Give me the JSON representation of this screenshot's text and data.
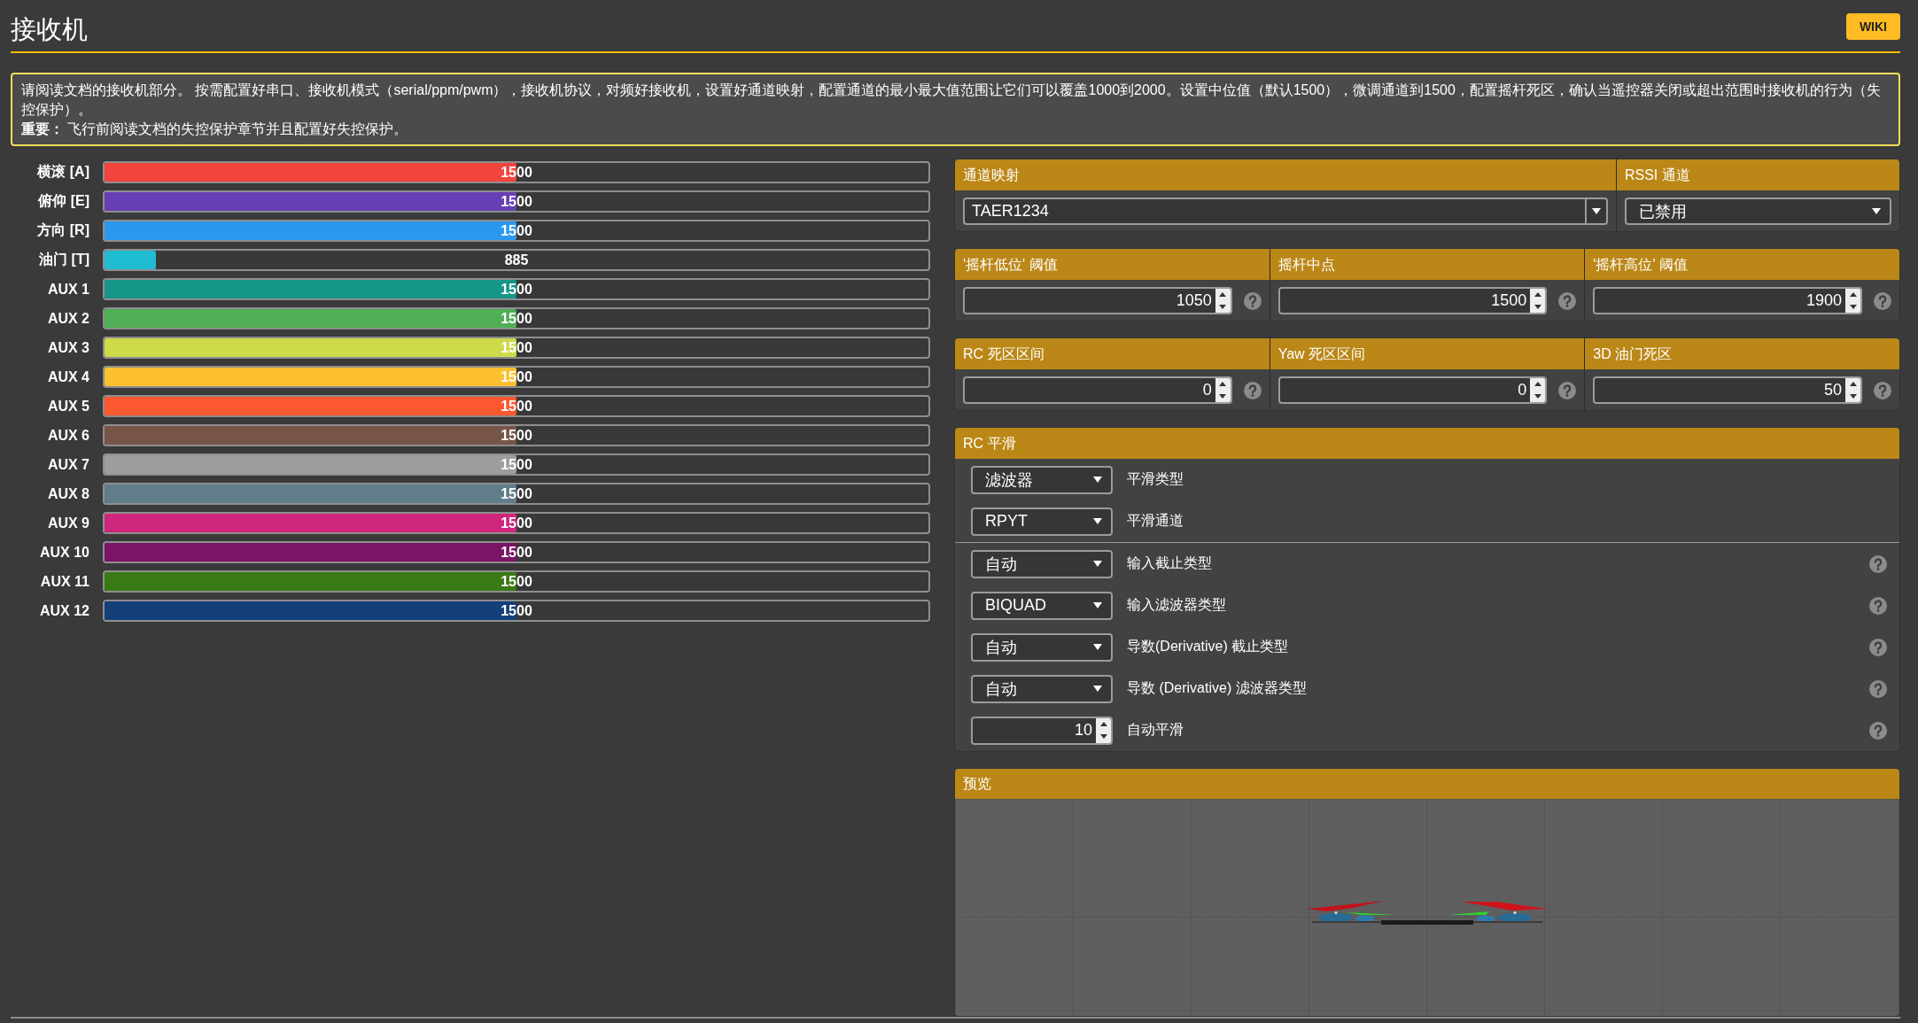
{
  "header": {
    "title": "接收机",
    "wiki": "WIKI"
  },
  "notice": {
    "text": "请阅读文档的接收机部分。 按需配置好串口、接收机模式（serial/ppm/pwm），接收机协议，对频好接收机，设置好通道映射，配置通道的最小最大值范围让它们可以覆盖1000到2000。设置中位值（默认1500），微调通道到1500，配置摇杆死区，确认当遥控器关闭或超出范围时接收机的行为（失控保护）。",
    "important": "**重要：** 飞行前阅读文档的失控保护章节并且配置好失控保护。"
  },
  "channels": [
    {
      "name": "横滚 [A]",
      "value": "1500",
      "level": 0.5,
      "color": "#f1453d"
    },
    {
      "name": "俯仰 [E]",
      "value": "1500",
      "level": 0.5,
      "color": "#673fb4"
    },
    {
      "name": "方向 [R]",
      "value": "1500",
      "level": 0.5,
      "color": "#2b98f0"
    },
    {
      "name": "油门 [T]",
      "value": "885",
      "level": 0.062,
      "color": "#1fbcd2"
    },
    {
      "name": "AUX 1",
      "value": "1500",
      "level": 0.5,
      "color": "#159688"
    },
    {
      "name": "AUX 2",
      "value": "1500",
      "level": 0.5,
      "color": "#50ae55"
    },
    {
      "name": "AUX 3",
      "value": "1500",
      "level": 0.5,
      "color": "#cdda49"
    },
    {
      "name": "AUX 4",
      "value": "1500",
      "level": 0.5,
      "color": "#fdc02f"
    },
    {
      "name": "AUX 5",
      "value": "1500",
      "level": 0.5,
      "color": "#fc5830"
    },
    {
      "name": "AUX 6",
      "value": "1500",
      "level": 0.5,
      "color": "#785549"
    },
    {
      "name": "AUX 7",
      "value": "1500",
      "level": 0.5,
      "color": "#9e9e9e"
    },
    {
      "name": "AUX 8",
      "value": "1500",
      "level": 0.5,
      "color": "#617d8a"
    },
    {
      "name": "AUX 9",
      "value": "1500",
      "level": 0.5,
      "color": "#cf267d"
    },
    {
      "name": "AUX 10",
      "value": "1500",
      "level": 0.5,
      "color": "#7a1464"
    },
    {
      "name": "AUX 11",
      "value": "1500",
      "level": 0.5,
      "color": "#3a7a14"
    },
    {
      "name": "AUX 12",
      "value": "1500",
      "level": 0.5,
      "color": "#14407a"
    }
  ],
  "settings_panels": [
    {
      "columns": [
        {
          "label": "通道映射",
          "kind": "combo",
          "value": "TAER1234"
        },
        {
          "label": "RSSI 通道",
          "kind": "select",
          "value": "已禁用"
        }
      ]
    },
    {
      "columns": [
        {
          "label": "'摇杆低位' 阈值",
          "kind": "number",
          "value": "1050",
          "help": true
        },
        {
          "label": "摇杆中点",
          "kind": "number",
          "value": "1500",
          "help": true
        },
        {
          "label": "'摇杆高位' 阈值",
          "kind": "number",
          "value": "1900",
          "help": true
        }
      ]
    },
    {
      "columns": [
        {
          "label": "RC 死区区间",
          "kind": "number",
          "value": "0",
          "help": true
        },
        {
          "label": "Yaw 死区区间",
          "kind": "number",
          "value": "0",
          "help": true
        },
        {
          "label": "3D 油门死区",
          "kind": "number",
          "value": "50",
          "help": true
        }
      ]
    }
  ],
  "rc_smoothing": {
    "title": "RC 平滑",
    "sections": [
      {
        "rows": [
          {
            "kind": "select",
            "value": "滤波器",
            "label": "平滑类型",
            "help": false
          },
          {
            "kind": "select",
            "value": "RPYT",
            "label": "平滑通道",
            "help": false
          }
        ]
      },
      {
        "rows": [
          {
            "kind": "select",
            "value": "自动",
            "label": "输入截止类型",
            "help": true
          },
          {
            "kind": "select",
            "value": "BIQUAD",
            "label": "输入滤波器类型",
            "help": true
          },
          {
            "kind": "select",
            "value": "自动",
            "label": "导数(Derivative) 截止类型",
            "help": true
          },
          {
            "kind": "select",
            "value": "自动",
            "label": "导数 (Derivative) 滤波器类型",
            "help": true
          },
          {
            "kind": "number",
            "value": "10",
            "label": "自动平滑",
            "help": true
          }
        ]
      }
    ]
  },
  "preview": {
    "title": "预览"
  }
}
